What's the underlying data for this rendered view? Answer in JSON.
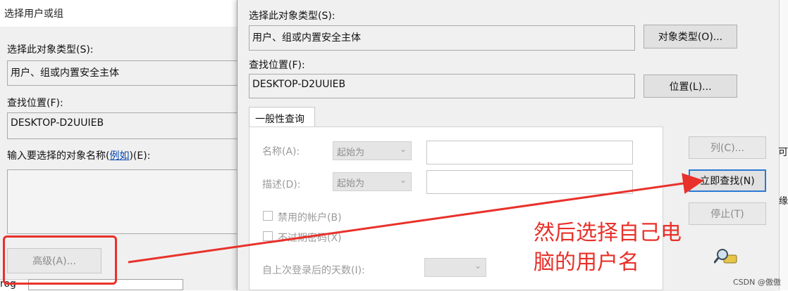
{
  "back_dialog": {
    "title": "选择用户或组",
    "object_type_label": "选择此对象类型(S):",
    "object_type_value": "用户、组或内置安全主体",
    "location_label": "查找位置(F):",
    "location_value": "DESKTOP-D2UUIEB",
    "enter_names_prefix": "输入要选择的对象名称(",
    "enter_names_link": "例如",
    "enter_names_suffix": ")(E):",
    "advanced_button": "高级(A)...",
    "bottom_partial_text": "rog"
  },
  "front_dialog": {
    "object_type_label": "选择此对象类型(S):",
    "object_type_value": "用户、组或内置安全主体",
    "object_types_button": "对象类型(O)...",
    "location_label": "查找位置(F):",
    "location_value": "DESKTOP-D2UUIEB",
    "locations_button": "位置(L)...",
    "tab_label": "一般性查询",
    "name_label": "名称(A):",
    "name_mode": "起始为",
    "description_label": "描述(D):",
    "description_mode": "起始为",
    "disabled_accounts_label": "禁用的帐户(B)",
    "non_expiring_label": "不过期密码(X)",
    "days_since_logon_label": "自上次登录后的天数(I):",
    "columns_button": "列(C)...",
    "find_now_button": "立即查找(N)",
    "stop_button": "停止(T)"
  },
  "edge_partial": {
    "text_1": "可,",
    "text_2": "缘"
  },
  "annotation": {
    "line1": "然后选择自己电",
    "line2": "脑的用户名",
    "color": "#e8312a"
  },
  "watermark": "CSDN @傲傲"
}
